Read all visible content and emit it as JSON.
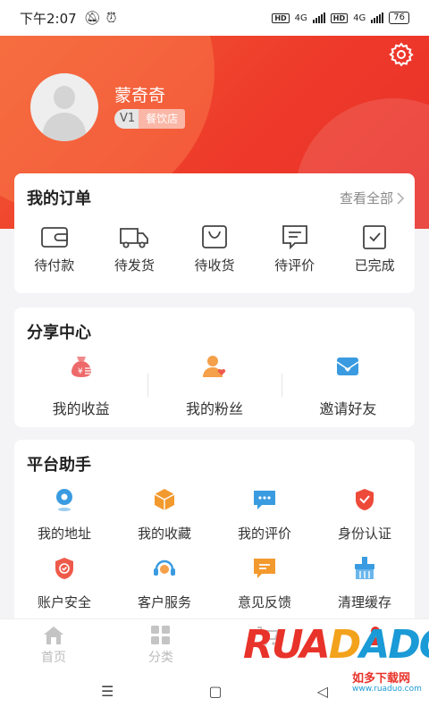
{
  "status_bar": {
    "time": "下午2:07",
    "network_1": "4G",
    "network_2": "4G",
    "hd": "HD",
    "battery": "76"
  },
  "profile": {
    "username": "蒙奇奇",
    "level": "V1",
    "shop_type": "餐饮店"
  },
  "orders": {
    "title": "我的订单",
    "view_all": "查看全部",
    "items": [
      {
        "label": "待付款",
        "icon": "wallet-icon"
      },
      {
        "label": "待发货",
        "icon": "truck-icon"
      },
      {
        "label": "待收货",
        "icon": "package-icon"
      },
      {
        "label": "待评价",
        "icon": "comment-icon"
      },
      {
        "label": "已完成",
        "icon": "clipboard-check-icon"
      }
    ]
  },
  "share_center": {
    "title": "分享中心",
    "items": [
      {
        "label": "我的收益",
        "icon": "money-bag-icon"
      },
      {
        "label": "我的粉丝",
        "icon": "fans-icon"
      },
      {
        "label": "邀请好友",
        "icon": "invite-mail-icon"
      }
    ]
  },
  "platform": {
    "title": "平台助手",
    "items": [
      {
        "label": "我的地址",
        "icon": "location-icon"
      },
      {
        "label": "我的收藏",
        "icon": "box-icon"
      },
      {
        "label": "我的评价",
        "icon": "chat-bubble-icon"
      },
      {
        "label": "身份认证",
        "icon": "id-shield-icon"
      },
      {
        "label": "账户安全",
        "icon": "security-shield-icon"
      },
      {
        "label": "客户服务",
        "icon": "headset-icon"
      },
      {
        "label": "意见反馈",
        "icon": "feedback-icon"
      },
      {
        "label": "清理缓存",
        "icon": "broom-icon"
      }
    ]
  },
  "tabs": [
    {
      "label": "首页",
      "icon": "home-icon"
    },
    {
      "label": "分类",
      "icon": "grid-icon"
    },
    {
      "label": "",
      "icon": "cart-icon"
    },
    {
      "label": "",
      "icon": "profile-icon"
    }
  ],
  "watermark": {
    "logo": "RUANDADO",
    "cn": "如多下载网",
    "url": "www.ruaduo.com"
  },
  "colors": {
    "header_red": "#ee3a2a",
    "accent_orange": "#f39a2e",
    "accent_blue": "#3a9be0"
  }
}
